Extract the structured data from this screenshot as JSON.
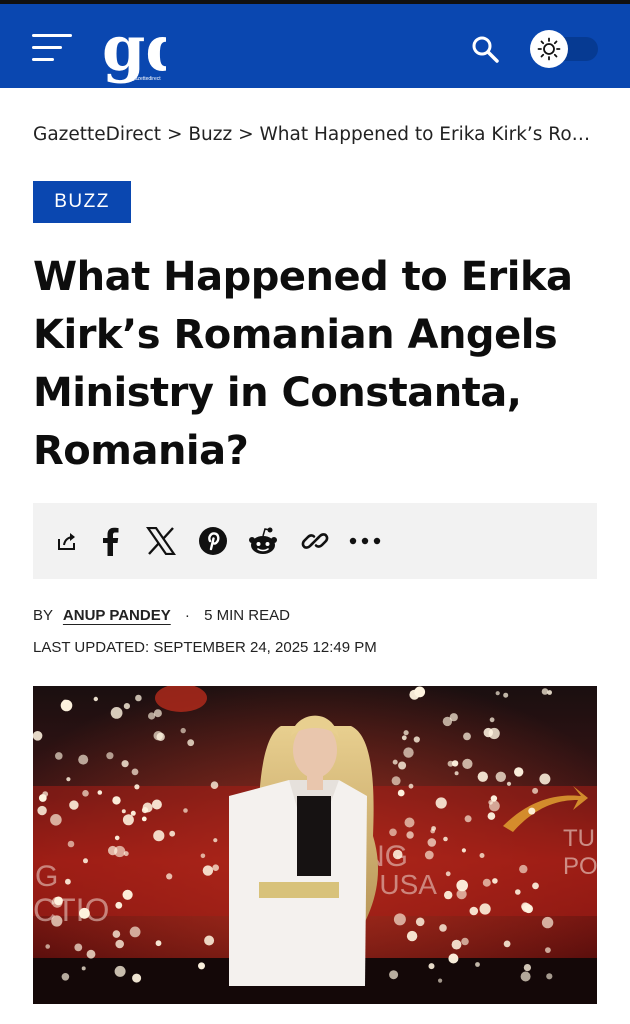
{
  "header": {
    "logo_text": "gd",
    "logo_tagline": "gazettedirect",
    "menu_icon": "hamburger-menu-icon",
    "search_icon": "search-icon",
    "theme_icon": "sun-icon",
    "colors": {
      "brand": "#0a47b0",
      "track": "#063a92",
      "text": "#ffffff"
    }
  },
  "breadcrumb": {
    "home": "GazetteDirect",
    "sep1": ">",
    "category": "Buzz",
    "sep2": ">",
    "current": "What Happened to Erika Kirk’s Romanian Angels Ministry in Constanta, Romania?"
  },
  "category_badge": "BUZZ",
  "article": {
    "title": "What Happened to Erika Kirk’s Romanian Angels Ministry in Constanta, Romania?",
    "by_label": "BY",
    "author": "ANUP PANDEY",
    "dot": "·",
    "read_time": "5 MIN READ",
    "updated_label": "LAST UPDATED:",
    "updated_date": "SEPTEMBER 24, 2025 12:49 PM"
  },
  "share_bar": {
    "icons": [
      "share-icon",
      "facebook-icon",
      "x-icon",
      "pinterest-icon",
      "reddit-icon",
      "copy-link-icon",
      "more-icon"
    ]
  },
  "hero_image": {
    "description_icon": "photo",
    "sign_text_left": "G\nCTIO",
    "sign_text_center": "NG\nT USA",
    "sign_text_right": "TU\nPO"
  }
}
